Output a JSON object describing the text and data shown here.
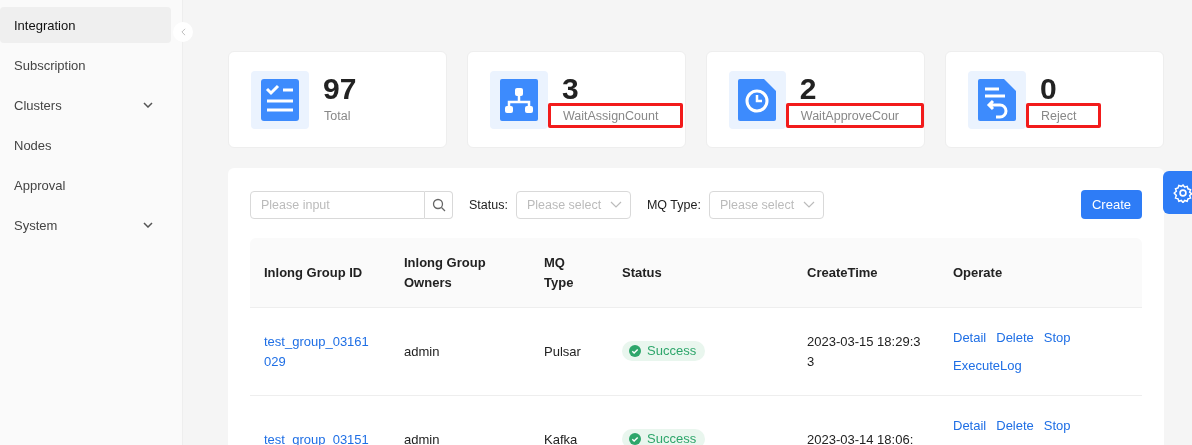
{
  "sidebar": {
    "items": [
      {
        "label": "Integration",
        "selected": true,
        "expandable": false
      },
      {
        "label": "Subscription",
        "selected": false,
        "expandable": false
      },
      {
        "label": "Clusters",
        "selected": false,
        "expandable": true
      },
      {
        "label": "Nodes",
        "selected": false,
        "expandable": false
      },
      {
        "label": "Approval",
        "selected": false,
        "expandable": false
      },
      {
        "label": "System",
        "selected": false,
        "expandable": true
      }
    ]
  },
  "stats": [
    {
      "kind": "list",
      "value": "97",
      "label": "Total",
      "highlighted": false
    },
    {
      "kind": "hierarchy",
      "value": "3",
      "label": "WaitAssignCount",
      "highlighted": true
    },
    {
      "kind": "clock",
      "value": "2",
      "label": "WaitApproveCour",
      "highlighted": true
    },
    {
      "kind": "return",
      "value": "0",
      "label": "Reject",
      "highlighted": true
    }
  ],
  "filters": {
    "search": {
      "placeholder": "Please input"
    },
    "selects": [
      {
        "label": "Status:",
        "placeholder": "Please select"
      },
      {
        "label": "MQ Type:",
        "placeholder": "Please select"
      }
    ],
    "create_button": "Create"
  },
  "table": {
    "columns": [
      "Inlong Group ID",
      "Inlong Group Owners",
      "MQ Type",
      "Status",
      "CreateTime",
      "Operate"
    ],
    "rows": [
      {
        "id": "test_group_03161029",
        "owner": "admin",
        "mq_type": "Pulsar",
        "status": "Success",
        "create_time": "2023-03-15 18:29:33",
        "actions": [
          "Detail",
          "Delete",
          "Stop",
          "ExecuteLog"
        ]
      },
      {
        "id": "test_group_03151",
        "owner": "admin",
        "mq_type": "Kafka",
        "status": "Success",
        "create_time": "2023-03-14 18:06:",
        "actions": [
          "Detail",
          "Delete",
          "Stop"
        ]
      }
    ]
  }
}
